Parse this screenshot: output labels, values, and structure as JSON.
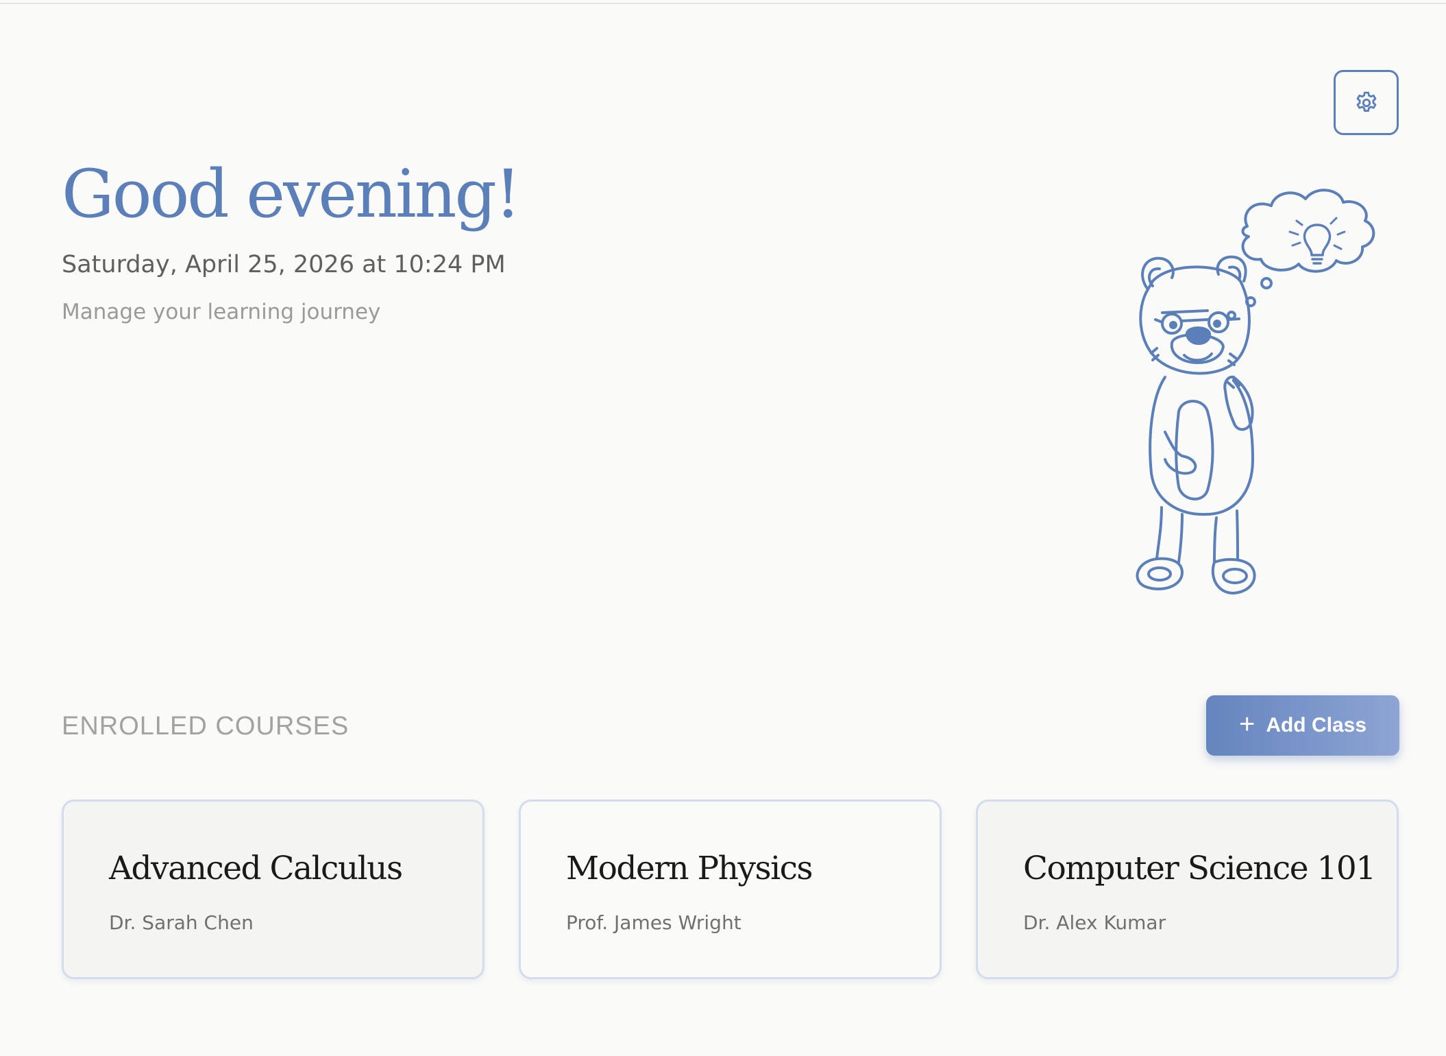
{
  "header": {
    "greeting": "Good evening!",
    "datetime": "Saturday, April 25, 2026 at 10:24 PM",
    "tagline": "Manage your learning journey",
    "settings_icon": "gear-icon"
  },
  "illustration": {
    "name": "thinking-bear-with-lightbulb-thought-bubble"
  },
  "courses_section": {
    "title": "ENROLLED COURSES",
    "add_button": {
      "icon": "+",
      "label": "Add Class"
    }
  },
  "courses": [
    {
      "name": "Advanced Calculus",
      "instructor": "Dr. Sarah Chen"
    },
    {
      "name": "Modern Physics",
      "instructor": "Prof. James Wright"
    },
    {
      "name": "Computer Science 101",
      "instructor": "Dr. Alex Kumar"
    }
  ],
  "colors": {
    "accent": "#5b7fb8",
    "background": "#fafaf8",
    "card_border": "#d3dced"
  }
}
